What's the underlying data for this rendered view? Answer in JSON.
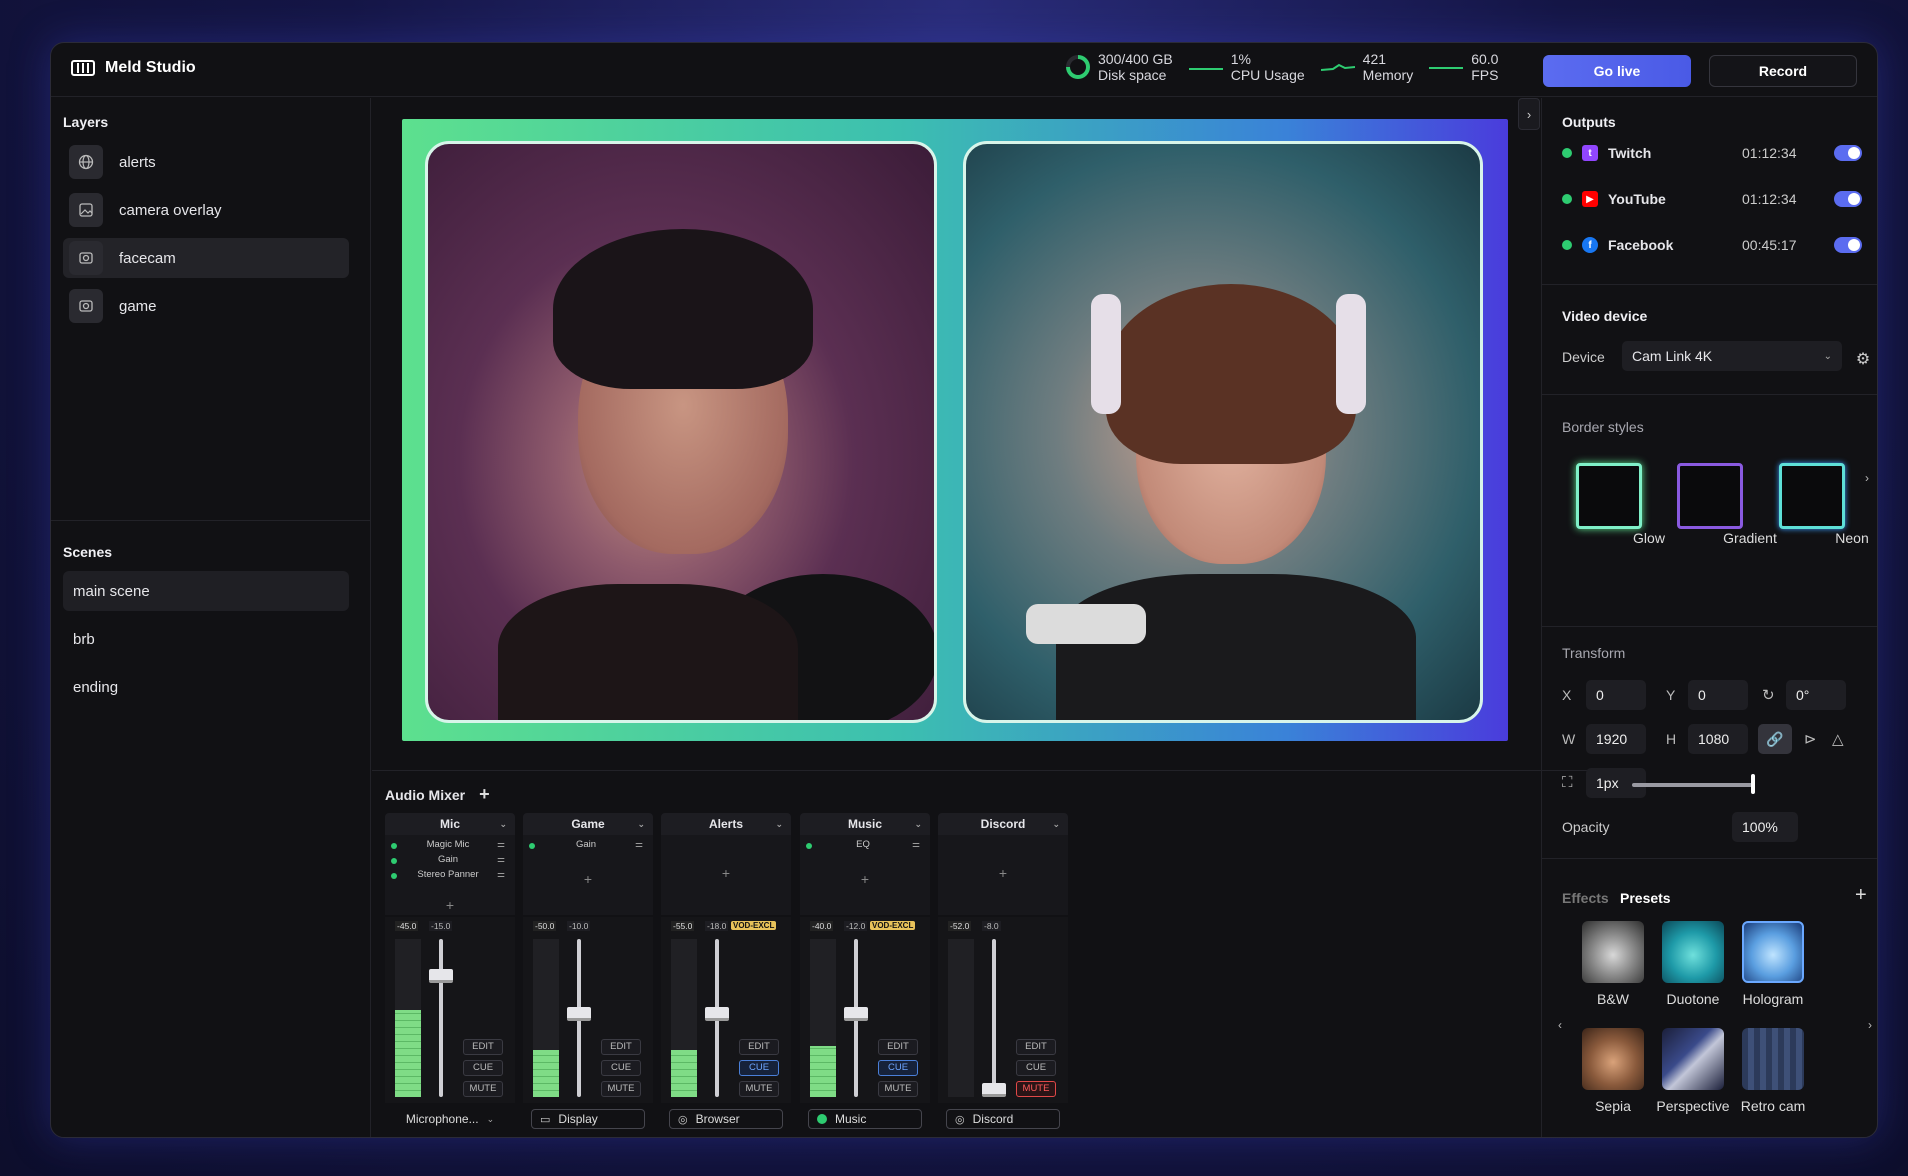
{
  "app": {
    "title": "Meld Studio"
  },
  "stats": [
    {
      "value": "300/400 GB",
      "label": "Disk space"
    },
    {
      "value": "1%",
      "label": "CPU Usage"
    },
    {
      "value": "421",
      "label": "Memory"
    },
    {
      "value": "60.0",
      "label": "FPS"
    }
  ],
  "disk_usage_fraction": 0.75,
  "actions": {
    "go_live": "Go live",
    "record": "Record"
  },
  "layers": {
    "title": "Layers",
    "items": [
      {
        "label": "alerts",
        "icon": "globe-icon"
      },
      {
        "label": "camera overlay",
        "icon": "image-icon"
      },
      {
        "label": "facecam",
        "icon": "camera-icon"
      },
      {
        "label": "game",
        "icon": "camera-icon"
      }
    ],
    "selected": "facecam"
  },
  "scenes": {
    "title": "Scenes",
    "items": [
      "main scene",
      "brb",
      "ending"
    ],
    "selected": "main scene"
  },
  "mixer": {
    "title": "Audio Mixer",
    "channels": [
      {
        "name": "Mic",
        "effects": [
          "Magic Mic",
          "Gain",
          "Stereo Panner"
        ],
        "db_a": "-45.0",
        "db_b": "-15.0",
        "badge": "",
        "level": 0.55,
        "fader": 0.8,
        "edit": "EDIT",
        "cue": "CUE",
        "mute": "MUTE",
        "cue_on": false,
        "mute_on": false,
        "source": "Microphone...",
        "source_icon": "chevron-down-icon"
      },
      {
        "name": "Game",
        "effects": [
          "Gain"
        ],
        "db_a": "-50.0",
        "db_b": "-10.0",
        "badge": "",
        "level": 0.3,
        "fader": 0.55,
        "edit": "EDIT",
        "cue": "CUE",
        "mute": "MUTE",
        "cue_on": false,
        "mute_on": false,
        "source": "Display",
        "source_icon": "monitor-icon"
      },
      {
        "name": "Alerts",
        "effects": [],
        "db_a": "-55.0",
        "db_b": "-18.0",
        "badge": "VOD-EXCL",
        "level": 0.3,
        "fader": 0.55,
        "edit": "EDIT",
        "cue": "CUE",
        "mute": "MUTE",
        "cue_on": true,
        "mute_on": false,
        "source": "Browser",
        "source_icon": "globe-icon"
      },
      {
        "name": "Music",
        "effects": [
          "EQ"
        ],
        "db_a": "-40.0",
        "db_b": "-12.0",
        "badge": "VOD-EXCL",
        "level": 0.32,
        "fader": 0.55,
        "edit": "EDIT",
        "cue": "CUE",
        "mute": "MUTE",
        "cue_on": true,
        "mute_on": false,
        "source": "Music",
        "source_icon": "spotify-icon"
      },
      {
        "name": "Discord",
        "effects": [],
        "db_a": "-52.0",
        "db_b": "-8.0",
        "badge": "",
        "level": 0.0,
        "fader": 0.0,
        "edit": "EDIT",
        "cue": "CUE",
        "mute": "MUTE",
        "cue_on": false,
        "mute_on": true,
        "source": "Discord",
        "source_icon": "globe-icon"
      }
    ]
  },
  "outputs": {
    "title": "Outputs",
    "items": [
      {
        "name": "Twitch",
        "time": "01:12:34",
        "enabled": true,
        "color": "#9146ff"
      },
      {
        "name": "YouTube",
        "time": "01:12:34",
        "enabled": true,
        "color": "#ff0000"
      },
      {
        "name": "Facebook",
        "time": "00:45:17",
        "enabled": true,
        "color": "#1877f2"
      }
    ]
  },
  "video_device": {
    "title": "Video device",
    "device_label": "Device",
    "device_value": "Cam Link 4K"
  },
  "border_styles": {
    "title": "Border styles",
    "items": [
      "Glow",
      "Gradient",
      "Neon"
    ]
  },
  "transform": {
    "title": "Transform",
    "x_label": "X",
    "x": "0",
    "y_label": "Y",
    "y": "0",
    "rotation": "0°",
    "w_label": "W",
    "w": "1920",
    "h_label": "H",
    "h": "1080",
    "border": "1px",
    "opacity_label": "Opacity",
    "opacity": "100%"
  },
  "effects_tabs": {
    "effects": "Effects",
    "presets": "Presets",
    "active": "Presets"
  },
  "presets": [
    "B&W",
    "Duotone",
    "Hologram",
    "Sepia",
    "Perspective",
    "Retro cam"
  ],
  "colors": {
    "accent": "#5b6cf0",
    "live_green": "#2ecc71",
    "mute_red": "#e04848"
  }
}
